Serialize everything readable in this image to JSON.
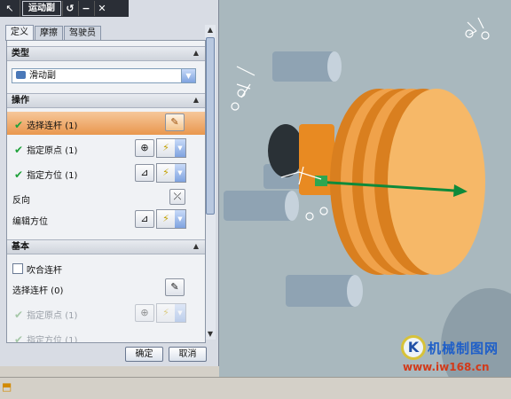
{
  "titlebar": {
    "title": "运动副",
    "buttons": [
      "↺",
      "−",
      "✕"
    ]
  },
  "tabs": [
    {
      "label": "定义",
      "active": true
    },
    {
      "label": "摩擦",
      "active": false
    },
    {
      "label": "驾驶员",
      "active": false
    }
  ],
  "sections": {
    "type": {
      "header": "类型",
      "value": "滑动副"
    },
    "operation": {
      "header": "操作",
      "select_link": "选择连杆 (1)",
      "specify_origin": "指定原点 (1)",
      "specify_orientation": "指定方位 (1)",
      "reverse": "反向",
      "edit_orientation": "编辑方位"
    },
    "base": {
      "header": "基本",
      "snap_link": "吹合连杆",
      "select_link": "选择连杆 (0)",
      "specify_origin": "指定原点 (1)",
      "specify_orientation": "指定方位 (1)"
    }
  },
  "footer": {
    "ok": "确定",
    "cancel": "取消"
  },
  "watermark": {
    "logo": "K",
    "text": "机械制图网",
    "url": "www.iw168.cn"
  },
  "colors": {
    "highlight": "#e9974e",
    "check": "#1fa13a",
    "part": "#f2a03a",
    "viewport": "#a9b8be"
  },
  "icons": {
    "type_icon": "slider-joint-icon",
    "pick": "select-link-icon",
    "point": "point-constructor-icon",
    "vector": "vector-constructor-icon",
    "reverse": "reverse-direction-icon"
  }
}
